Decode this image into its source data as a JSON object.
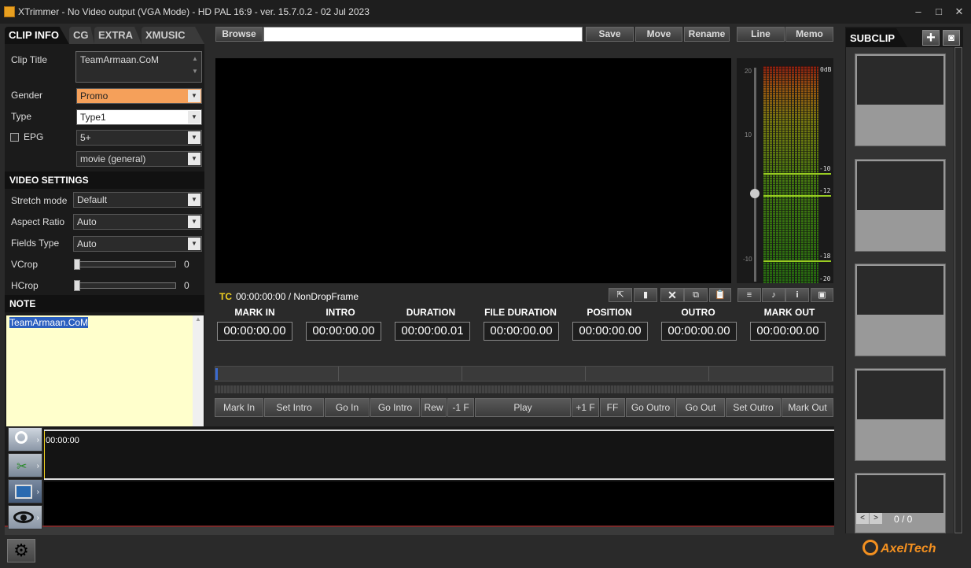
{
  "app": {
    "title": "XTrimmer - No Video output (VGA Mode) - HD PAL 16:9 - ver. 15.7.0.2 - 02 Jul 2023",
    "window_buttons": [
      "‒",
      "□",
      "✕"
    ]
  },
  "tabs": [
    "CLIP INFO",
    "CG",
    "EXTRA",
    "XMUSIC"
  ],
  "clip_info": {
    "clip_title_label": "Clip Title",
    "clip_title_value": "TeamArmaan.CoM",
    "gender_label": "Gender",
    "gender_value": "Promo",
    "type_label": "Type",
    "type_value": "Type1",
    "epg_label": "EPG",
    "epg_value": "5+",
    "category_value": "movie (general)"
  },
  "video_settings": {
    "header": "VIDEO SETTINGS",
    "stretch_label": "Stretch mode",
    "stretch_value": "Default",
    "aspect_label": "Aspect Ratio",
    "aspect_value": "Auto",
    "fields_label": "Fields Type",
    "fields_value": "Auto",
    "vcrop_label": "VCrop",
    "vcrop_value": "0",
    "hcrop_label": "HCrop",
    "hcrop_value": "0"
  },
  "note": {
    "header": "NOTE",
    "text": "TeamArmaan.CoM"
  },
  "toolbar": {
    "browse": "Browse",
    "path_value": "",
    "save": "Save",
    "move": "Move",
    "rename": "Rename",
    "line": "Line",
    "memo": "Memo"
  },
  "meter": {
    "left_scale": [
      "20",
      "10",
      "-10"
    ],
    "right_scale": [
      "0dB",
      "-10",
      "-12",
      "-18",
      "-20"
    ]
  },
  "timecode": {
    "tc_label": "TC",
    "tc_value": "00:00:00:00 / NonDropFrame"
  },
  "tc_columns": [
    {
      "label": "MARK IN",
      "value": "00:00:00.00"
    },
    {
      "label": "INTRO",
      "value": "00:00:00.00"
    },
    {
      "label": "DURATION",
      "value": "00:00:00.01"
    },
    {
      "label": "FILE DURATION",
      "value": "00:00:00.00"
    },
    {
      "label": "POSITION",
      "value": "00:00:00.00"
    },
    {
      "label": "OUTRO",
      "value": "00:00:00.00"
    },
    {
      "label": "MARK OUT",
      "value": "00:00:00.00"
    }
  ],
  "transport": [
    "Mark In",
    "Set Intro",
    "Go In",
    "Go Intro",
    "Rew",
    "-1 F",
    "Play",
    "+1 F",
    "FF",
    "Go Outro",
    "Go Out",
    "Set Outro",
    "Mark Out"
  ],
  "timeline": {
    "time_label": "00:00:00"
  },
  "subclip": {
    "header": "SUBCLIP",
    "counter": "0 / 0",
    "prev": "<",
    "next": ">"
  },
  "brand": {
    "name": "AxelTech"
  },
  "colors": {
    "accent_orange": "#f5a05a",
    "note_bg": "#ffffcc",
    "tc_label": "#f0d020"
  }
}
